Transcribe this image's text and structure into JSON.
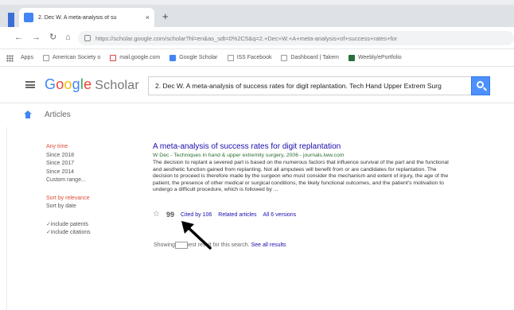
{
  "browser": {
    "tab_title": "2. Dec W. A meta-analysis of su",
    "new_tab": "+",
    "close": "×",
    "url": "https://scholar.google.com/scholar?hl=en&as_sdt=0%2C5&q=2.+Dec+W.+A+meta-analysis+of+success+rates+for",
    "bookmarks": [
      "Apps",
      "American Society o",
      "mail.google.com",
      "Google Scholar",
      "ISS Facebook",
      "Dashboard | Takem",
      "Weebly/ePortfolio"
    ]
  },
  "header": {
    "logo": [
      "G",
      "o",
      "o",
      "g",
      "l",
      "e"
    ],
    "logo_suffix": "Scholar",
    "search_value": "2. Dec W. A meta-analysis of success rates for digit replantation. Tech Hand Upper Extrem Surg"
  },
  "articles_label": "Articles",
  "sidebar": {
    "time_filters": [
      "Any time",
      "Since 2018",
      "Since 2017",
      "Since 2014",
      "Custom range..."
    ],
    "sort_options": [
      "Sort by relevance",
      "Sort by date"
    ],
    "checks": [
      "include patents",
      "include citations"
    ]
  },
  "result": {
    "title": "A meta-analysis of success rates for digit replantation",
    "meta": "W Dec - Techniques in hand & upper extremity surgery, 2006 - journals.lww.com",
    "snippet": "The decision to replant a severed part is based on the numerous factors that influence survival of the part and the functional and aesthetic function gained from replanting. Not all amputees will benefit from or are candidates for replantation. The decision to proceed is therefore made by the surgeon who must consider the mechanism and extent of injury, the age of the patient, the presence of other medical or surgical conditions, the likely functional outcomes, and the patient's motivation to undergo a difficult procedure, which is followed by ...",
    "star": "☆",
    "cite": "99",
    "cited_by": "Cited by 106",
    "related": "Related articles",
    "versions": "All 6 versions"
  },
  "summary": {
    "prefix": "Showing the best result for this search.",
    "see_all": "See all results"
  },
  "colors": {
    "accent": "#4285f4",
    "link": "#1a0dab",
    "active_filter": "#dd4b39",
    "search_button": "#4d90fe"
  }
}
